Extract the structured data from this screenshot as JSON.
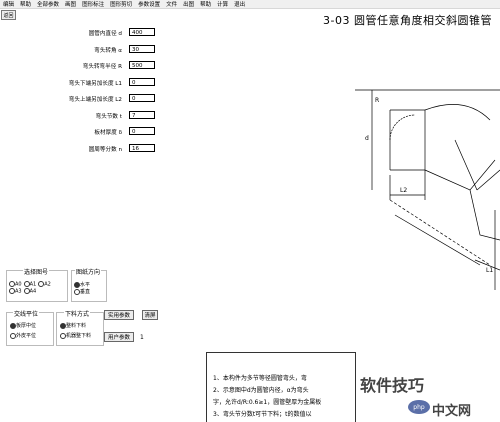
{
  "menu": [
    "编辑",
    "帮助",
    "全部参数",
    "画图",
    "图形标注",
    "图形剪切",
    "参数设置",
    "文件",
    "出图",
    "帮助",
    "计算",
    "退出"
  ],
  "back_button": "返回",
  "title": "3-03 圆管任意角度相交斜圆锥管",
  "params": [
    {
      "label": "圆管内直径 d",
      "value": "400"
    },
    {
      "label": "弯头转角 α",
      "value": "30"
    },
    {
      "label": "弯头转弯半径 R",
      "value": "500"
    },
    {
      "label": "弯头下端另加长度 L1",
      "value": "0"
    },
    {
      "label": "弯头上端另加长度 L2",
      "value": "0"
    },
    {
      "label": "弯头节数 t",
      "value": "7"
    },
    {
      "label": "板材厚度 δ",
      "value": "0"
    },
    {
      "label": "圆周等分数 n",
      "value": "16"
    }
  ],
  "paper_group": {
    "title": "选择图号",
    "options": [
      "A0",
      "A1",
      "A2",
      "A3",
      "A4"
    ]
  },
  "orientation_group": {
    "title": "图纸方向",
    "options": [
      "水平",
      "垂直"
    ]
  },
  "joint_group": {
    "title": "交线平位",
    "options": [
      "板厚中位",
      "外皮平位"
    ]
  },
  "cut_group": {
    "title": "下料方式",
    "options": [
      "整料下料",
      "机器整下料"
    ]
  },
  "buttons": {
    "practical": "实用参数",
    "clear": "清屏",
    "user": "用户参数",
    "user_value": "1"
  },
  "drawing_labels": {
    "R": "R",
    "d": "d",
    "L2": "L2",
    "L1": "L1"
  },
  "notes": [
    "1、本构件为多节等径圆管弯头，弯",
    "2、示意图中d为圆管内径，α为弯头",
    "字，允许d/R:0.6≥1，圆管壁厚为金属板",
    "3、弯头节分数t可节下料；t的数值以"
  ],
  "watermark": {
    "a": "软件技巧",
    "b": "php",
    "c": "中文网"
  }
}
